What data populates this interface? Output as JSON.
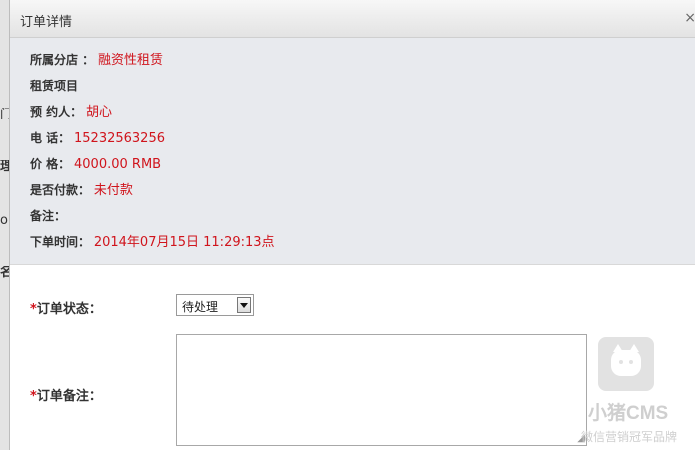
{
  "dialog": {
    "title": "订单详情",
    "close": "×"
  },
  "info": [
    {
      "label": "所属分店 ：",
      "value": "融资性租赁"
    },
    {
      "label": "租赁项目",
      "value": ""
    },
    {
      "label": "预 约人：",
      "value": "胡心"
    },
    {
      "label": "电 话：",
      "value": "15232563256"
    },
    {
      "label": "价 格：",
      "value": "4000.00 RMB"
    },
    {
      "label": "是否付款：",
      "value": "未付款"
    },
    {
      "label": "备注：",
      "value": ""
    },
    {
      "label": "下单时间：",
      "value": "2014年07月15日 11:29:13点"
    }
  ],
  "form": {
    "required_mark": "*",
    "status_label": "订单状态：",
    "status_value": "待处理",
    "remark_label": "订单备注：",
    "remark_value": ""
  },
  "watermark": {
    "brand": "小猪CMS",
    "slogan": "微信营销冠军品牌"
  },
  "background": {
    "fragments": [
      "门",
      "理",
      "ol",
      "名"
    ]
  }
}
